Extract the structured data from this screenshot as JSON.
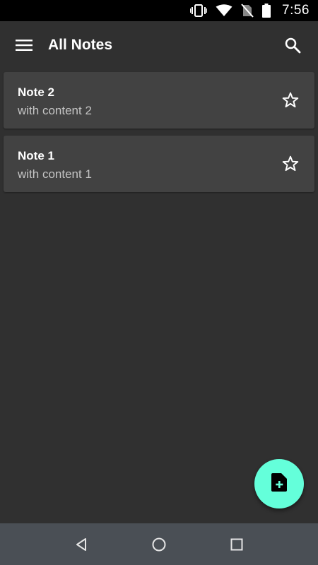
{
  "status_bar": {
    "time": "7:56",
    "icons": [
      "vibrate-icon",
      "wifi-icon",
      "no-sim-icon",
      "battery-icon"
    ]
  },
  "app_bar": {
    "title": "All Notes",
    "menu_icon": "hamburger-menu-icon",
    "search_icon": "search-icon"
  },
  "notes": [
    {
      "title": "Note 2",
      "content": "with content 2",
      "starred": false
    },
    {
      "title": "Note 1",
      "content": "with content 1",
      "starred": false
    }
  ],
  "fab": {
    "icon": "add-note-icon",
    "color": "#64ffda"
  },
  "nav_bar": {
    "buttons": [
      "back-icon",
      "home-icon",
      "recents-icon"
    ]
  },
  "colors": {
    "background": "#303030",
    "card": "#424242",
    "accent": "#64ffda",
    "nav_bar": "#4a4f55"
  }
}
